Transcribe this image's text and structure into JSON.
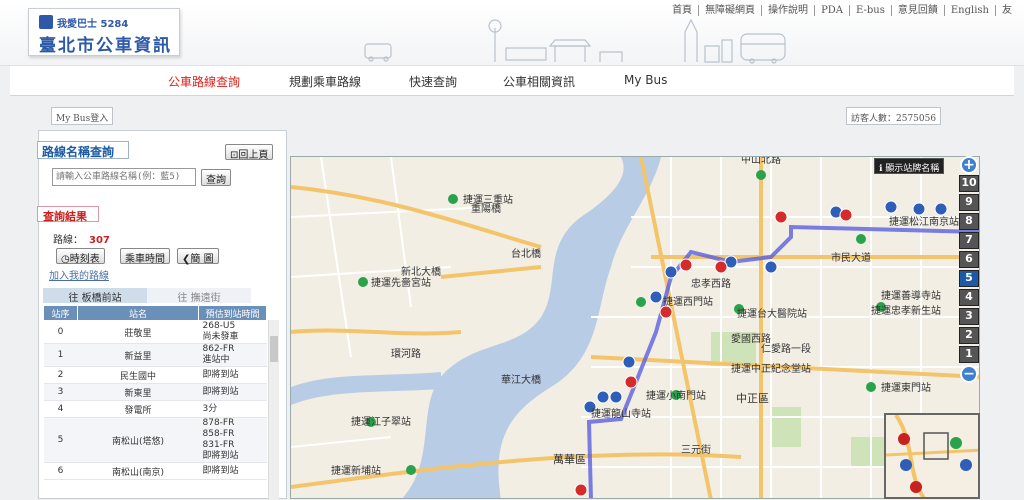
{
  "header": {
    "logo_sub": "我愛巴士 5284",
    "logo_main": "臺北市公車資訊",
    "links": [
      "首頁",
      "無障礙網頁",
      "操作說明",
      "PDA",
      "E-bus",
      "意見回饋",
      "English",
      "友"
    ]
  },
  "nav": {
    "items": [
      "公車路線查詢",
      "規劃乘車路線",
      "快速查詢",
      "公車相關資訊",
      "My Bus"
    ]
  },
  "mybus_login": "My Bus登入",
  "visitor_count": "訪客人數：2575056",
  "search": {
    "title": "路線名稱查詢",
    "back_label": "回上頁",
    "placeholder": "請輸入公車路線名稱(例：藍5)",
    "query_label": "查詢"
  },
  "results": {
    "title": "查詢結果",
    "route_label": "路線：",
    "route_number": "307",
    "timetable_label": "時刻表",
    "fare_label": "乘車時間",
    "simple_label": "簡 圖",
    "add_fav": "加入我的路線",
    "dir_to": "往 板橋前站",
    "dir_back": "往 撫遠街",
    "columns": [
      "站序",
      "站名",
      "預估到站時間"
    ],
    "rows": [
      {
        "seq": "0",
        "name": "莊敬里",
        "eta": [
          "268-U5",
          "尚未發車"
        ]
      },
      {
        "seq": "1",
        "name": "新益里",
        "eta": [
          "862-FR",
          "進站中"
        ]
      },
      {
        "seq": "2",
        "name": "民生國中",
        "eta": [
          "即將到站"
        ]
      },
      {
        "seq": "3",
        "name": "新東里",
        "eta": [
          "即將到站"
        ]
      },
      {
        "seq": "4",
        "name": "發電所",
        "eta": [
          "3分"
        ]
      },
      {
        "seq": "5",
        "name": "南松山(塔悠)",
        "eta": [
          "878-FR",
          "858-FR",
          "831-FR",
          "即將到站"
        ]
      },
      {
        "seq": "6",
        "name": "南松山(南京)",
        "eta": [
          "即將到站"
        ]
      }
    ]
  },
  "map": {
    "stop_toggle": "顯示站牌名稱",
    "zoom_levels": [
      "10",
      "9",
      "8",
      "7",
      "6",
      "5",
      "4",
      "3",
      "2",
      "1"
    ],
    "selected_zoom": "5",
    "labels": [
      "捷運三重站",
      "捷運先嗇宮站",
      "捷運龍山寺站",
      "捷運西門站",
      "捷運台大醫院站",
      "捷運小南門站",
      "捷運中正紀念堂站",
      "捷運善導寺站",
      "捷運忠孝新生站",
      "捷運松江南京站",
      "捷運東門站",
      "中正區",
      "萬華區",
      "捷運新埔站",
      "捷運江子翠站",
      "市民大道",
      "忠孝西路",
      "愛國西路",
      "仁愛路一段",
      "三元街",
      "華江大橋",
      "新北大橋",
      "環河路",
      "重陽橋",
      "台北橋",
      "中山北路"
    ]
  }
}
